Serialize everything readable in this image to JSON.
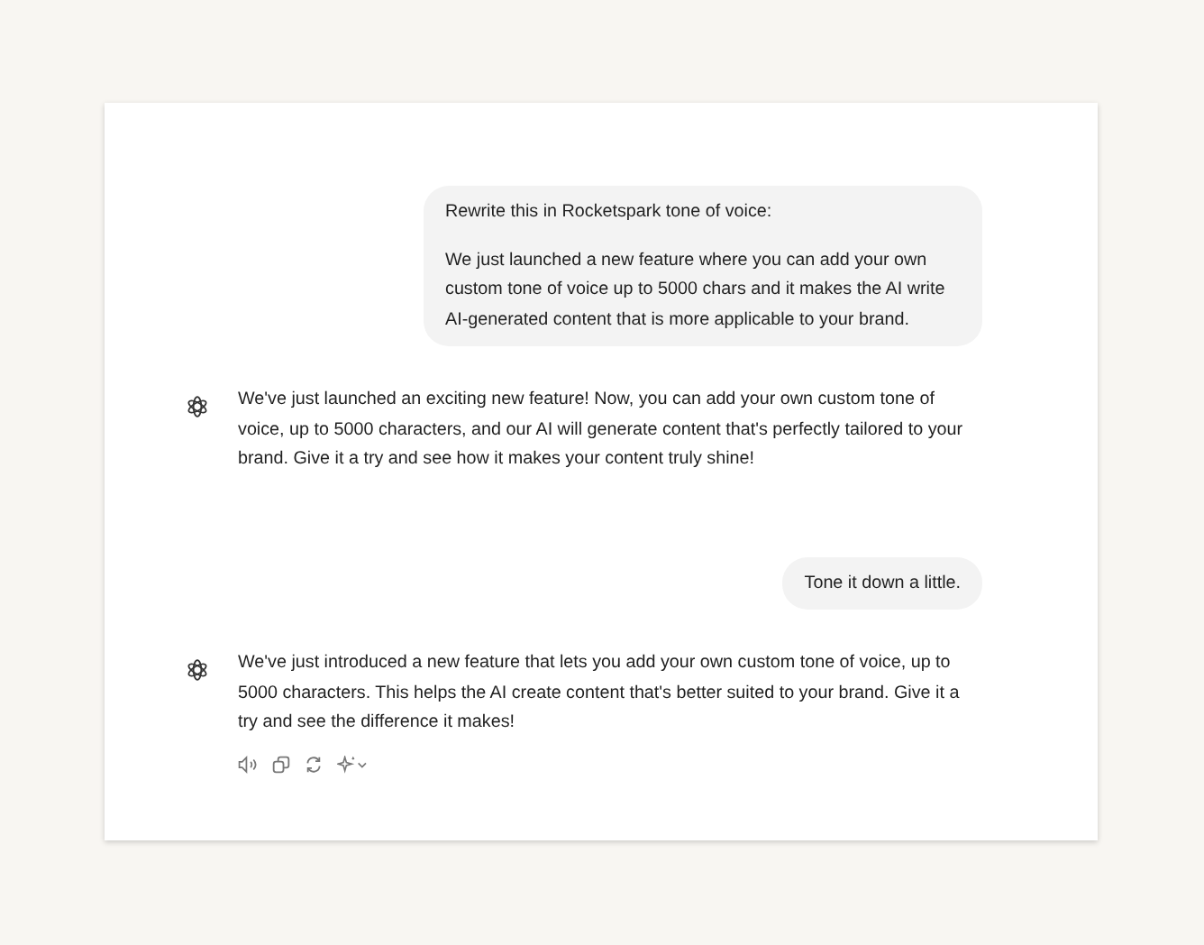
{
  "messages": [
    {
      "kind": "user",
      "paragraphs": [
        "Rewrite this in Rocketspark tone of voice:",
        "We just launched a new feature where you can add your own custom tone of voice up to 5000 chars and it makes the AI write AI-generated content that is more applicable to your brand."
      ]
    },
    {
      "kind": "assistant",
      "paragraphs": [
        "We've just launched an exciting new feature! Now, you can add your own custom tone of voice, up to 5000 characters, and our AI will generate content that's perfectly tailored to your brand. Give it a try and see how it makes your content truly shine!"
      ],
      "show_actions": false
    },
    {
      "kind": "user",
      "paragraphs": [
        "Tone it down a little."
      ]
    },
    {
      "kind": "assistant",
      "paragraphs": [
        "We've just introduced a new feature that lets you add your own custom tone of voice, up to 5000 characters. This helps the AI create content that's better suited to your brand. Give it a try and see the difference it makes!"
      ],
      "show_actions": true
    }
  ]
}
